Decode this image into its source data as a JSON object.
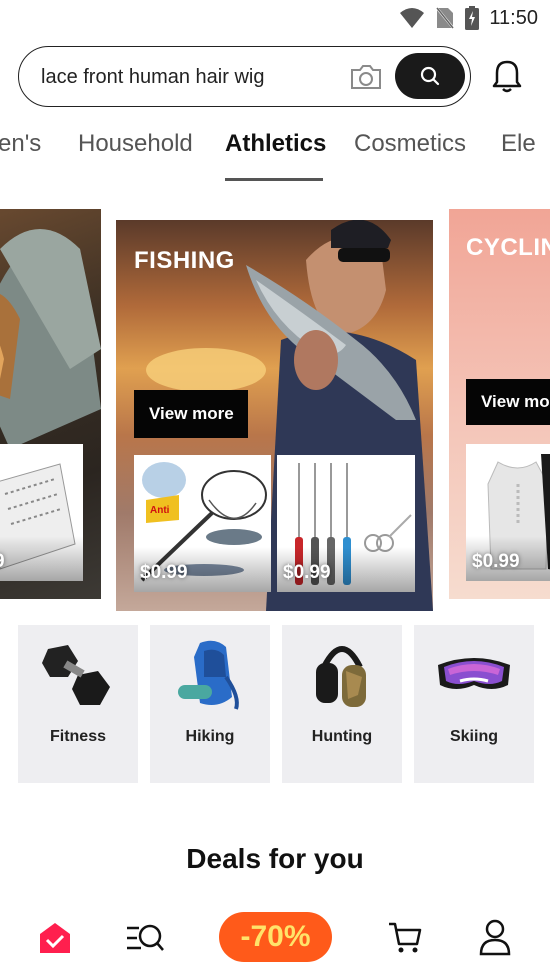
{
  "status_bar": {
    "time": "11:50"
  },
  "search": {
    "query": "lace front human hair wig"
  },
  "tabs": [
    {
      "label": "en's"
    },
    {
      "label": "Household"
    },
    {
      "label": "Athletics"
    },
    {
      "label": "Cosmetics"
    },
    {
      "label": "Ele"
    }
  ],
  "active_tab": "Athletics",
  "carousel": {
    "left_card": {
      "price": "9"
    },
    "main_card": {
      "title": "FISHING",
      "button_label": "View more",
      "prices": [
        "$0.99",
        "$0.99"
      ],
      "anti_badge": "Anti"
    },
    "right_card": {
      "title": "CYCLIN",
      "button_label": "View mo",
      "price": "$0.99"
    }
  },
  "categories": [
    {
      "label": "Fitness",
      "icon": "dumbbells-icon"
    },
    {
      "label": "Hiking",
      "icon": "backpack-icon"
    },
    {
      "label": "Hunting",
      "icon": "earmuffs-icon"
    },
    {
      "label": "Skiing",
      "icon": "goggles-icon"
    }
  ],
  "deals": {
    "title": "Deals for you"
  },
  "bottom_nav": {
    "discount_label": "-70%"
  },
  "colors": {
    "accent": "#ff1f4e",
    "discount_bg": "#ff5a1a",
    "discount_text": "#ffe36a",
    "search_button": "#1a1a1a"
  }
}
